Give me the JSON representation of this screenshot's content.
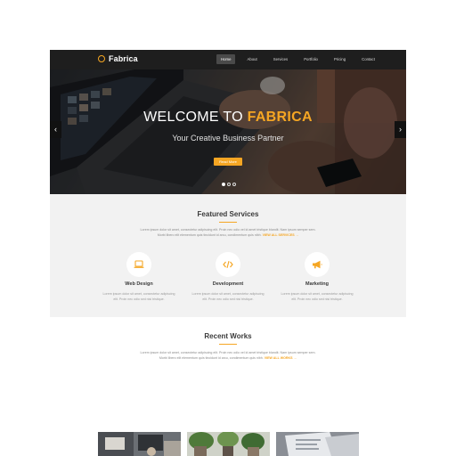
{
  "brand": {
    "name": "Fabrica",
    "accent": "#f5a623"
  },
  "nav": {
    "links": [
      "Home",
      "About",
      "Services",
      "Portfolio",
      "Pricing",
      "Contact"
    ],
    "active_index": 0
  },
  "hero": {
    "title_prefix": "WELCOME TO ",
    "title_highlight": "FABRICA",
    "subtitle": "Your Creative Business Partner",
    "button": "Read More",
    "prev_icon": "‹",
    "next_icon": "›",
    "slide_count": 3,
    "active_slide": 0
  },
  "services": {
    "title": "Featured Services",
    "intro_line1": "Lorem ipsum dolor sit amet, consectetur adipiscing elit. Proin nec odio vel id amet tristique blandit. Nam ipsum semper sem.",
    "intro_line2": "Morbi libero elit elementum quis tincidunt id arcu, condimentum quis nibh.",
    "intro_link": "VIEW ALL SERVICES →",
    "items": [
      {
        "icon": "laptop-icon",
        "title": "Web Design",
        "text1": "Lorem ipsum dolor sit amet, consectetur adipiscing",
        "text2": "elit. Proin nec odio sed nisi tristique."
      },
      {
        "icon": "code-icon",
        "title": "Development",
        "text1": "Lorem ipsum dolor sit amet, consectetur adipiscing",
        "text2": "elit. Proin nec odio sed nisi tristique."
      },
      {
        "icon": "megaphone-icon",
        "title": "Marketing",
        "text1": "Lorem ipsum dolor sit amet, consectetur adipiscing",
        "text2": "elit. Proin nec odio sed nisi tristique."
      }
    ]
  },
  "works": {
    "title": "Recent Works",
    "intro_line1": "Lorem ipsum dolor sit amet, consectetur adipiscing elit. Proin nec odio vel id amet tristique blandit. Nam ipsum semper sem.",
    "intro_line2": "Morbi libero elit elementum quis tincidunt id arcu, condimentum quis nibh.",
    "intro_link": "VIEW ALL WORKS →",
    "thumbnails": [
      "work-photo-desk",
      "work-photo-plants",
      "work-photo-papers"
    ]
  }
}
